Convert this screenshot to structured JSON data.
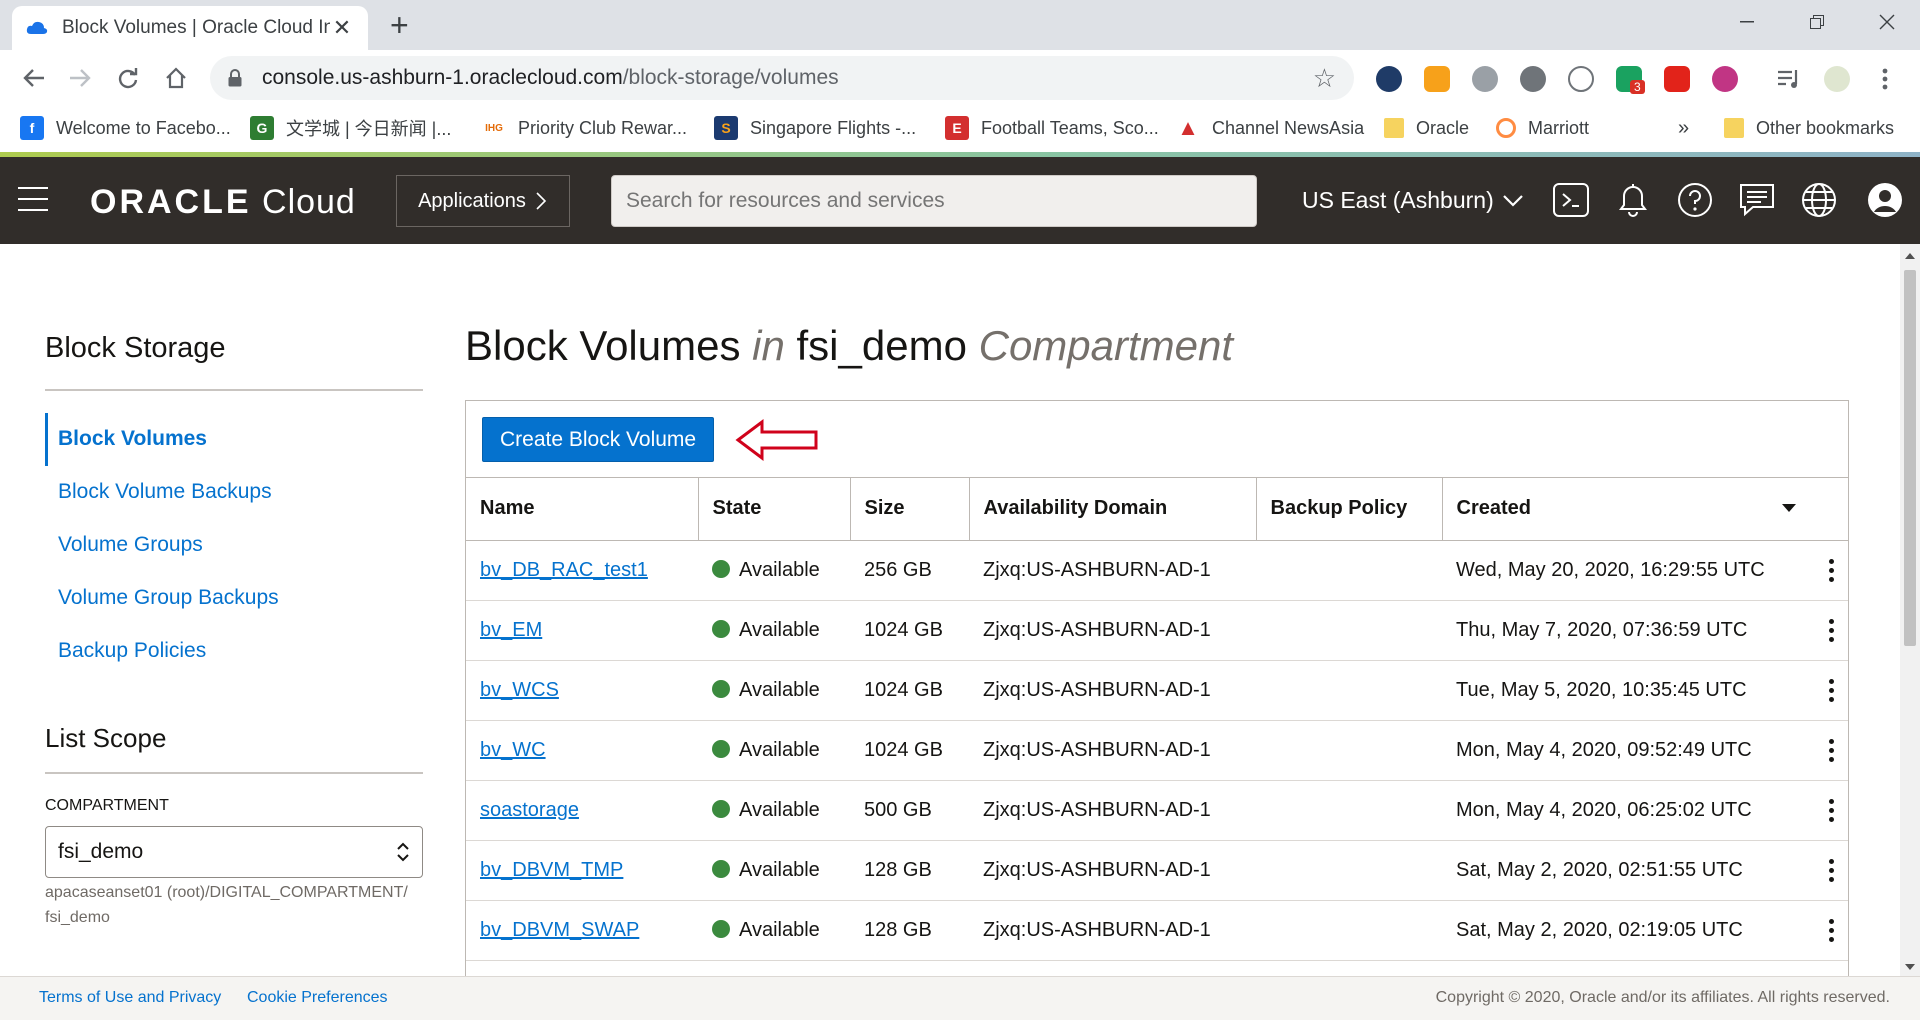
{
  "browser": {
    "tab_title": "Block Volumes | Oracle Cloud Inf",
    "new_tab": "+",
    "url_host": "console.us-ashburn-1.oraclecloud.com",
    "url_path": "/block-storage/volumes",
    "ext_badge": "3",
    "bookmarks": [
      {
        "label": "Welcome to Facebo...",
        "icon": "facebook-icon",
        "color": "#1877f2",
        "glyph": "f"
      },
      {
        "label": "文学城 | 今日新闻 |...",
        "icon": "wenxuecity-icon",
        "color": "#2e7d32",
        "glyph": "G"
      },
      {
        "label": "Priority Club Rewar...",
        "icon": "ihg-icon",
        "color": "#e46c0a",
        "glyph": "IHG"
      },
      {
        "label": "Singapore Flights -...",
        "icon": "singapore-airlines-icon",
        "color": "#1b3a70",
        "glyph": "S"
      },
      {
        "label": "Football Teams, Sco...",
        "icon": "espn-icon",
        "color": "#d32f2f",
        "glyph": "E"
      },
      {
        "label": "Channel NewsAsia",
        "icon": "cna-icon",
        "color": "#d32f2f",
        "glyph": "A"
      },
      {
        "label": "Oracle",
        "icon": "folder-icon"
      },
      {
        "label": "Marriott",
        "icon": "marriott-icon",
        "color": "#ff8c42",
        "glyph": "○"
      }
    ],
    "more_bookmarks": "»",
    "other_bookmarks": "Other bookmarks"
  },
  "header": {
    "logo_bold": "ORACLE",
    "logo_light": " Cloud",
    "applications_label": "Applications",
    "search_placeholder": "Search for resources and services",
    "region_label": "US East (Ashburn)"
  },
  "sidebar": {
    "title": "Block Storage",
    "items": [
      {
        "label": "Block Volumes",
        "active": true
      },
      {
        "label": "Block Volume Backups"
      },
      {
        "label": "Volume Groups"
      },
      {
        "label": "Volume Group Backups"
      },
      {
        "label": "Backup Policies"
      }
    ],
    "scope_title": "List Scope",
    "compartment_label": "COMPARTMENT",
    "compartment_value": "fsi_demo",
    "compartment_path_1": "apacaseanset01 (root)/DIGITAL_COMPARTMENT/",
    "compartment_path_2": "fsi_demo"
  },
  "main": {
    "title_a": "Block Volumes ",
    "title_in": "in",
    "title_b": " fsi_demo ",
    "title_c": "Compartment",
    "create_button": "Create Block Volume",
    "columns": [
      "Name",
      "State",
      "Size",
      "Availability Domain",
      "Backup Policy",
      "Created"
    ],
    "rows": [
      {
        "name": "bv_DB_RAC_test1",
        "state": "Available",
        "size": "256 GB",
        "ad": "Zjxq:US-ASHBURN-AD-1",
        "policy": "",
        "created": "Wed, May 20, 2020, 16:29:55 UTC"
      },
      {
        "name": "bv_EM",
        "state": "Available",
        "size": "1024 GB",
        "ad": "Zjxq:US-ASHBURN-AD-1",
        "policy": "",
        "created": "Thu, May 7, 2020, 07:36:59 UTC"
      },
      {
        "name": "bv_WCS",
        "state": "Available",
        "size": "1024 GB",
        "ad": "Zjxq:US-ASHBURN-AD-1",
        "policy": "",
        "created": "Tue, May 5, 2020, 10:35:45 UTC"
      },
      {
        "name": "bv_WC",
        "state": "Available",
        "size": "1024 GB",
        "ad": "Zjxq:US-ASHBURN-AD-1",
        "policy": "",
        "created": "Mon, May 4, 2020, 09:52:49 UTC"
      },
      {
        "name": "soastorage",
        "state": "Available",
        "size": "500 GB",
        "ad": "Zjxq:US-ASHBURN-AD-1",
        "policy": "",
        "created": "Mon, May 4, 2020, 06:25:02 UTC"
      },
      {
        "name": "bv_DBVM_TMP",
        "state": "Available",
        "size": "128 GB",
        "ad": "Zjxq:US-ASHBURN-AD-1",
        "policy": "",
        "created": "Sat, May 2, 2020, 02:51:55 UTC"
      },
      {
        "name": "bv_DBVM_SWAP",
        "state": "Available",
        "size": "128 GB",
        "ad": "Zjxq:US-ASHBURN-AD-1",
        "policy": "",
        "created": "Sat, May 2, 2020, 02:19:05 UTC"
      }
    ]
  },
  "footer": {
    "terms": "Terms of Use and Privacy",
    "cookies": "Cookie Preferences",
    "copyright": "Copyright © 2020, Oracle and/or its affiliates. All rights reserved."
  },
  "colors": {
    "accent": "#0572ce",
    "header_bg": "#312d2a",
    "available": "#3b8a3e",
    "annotation": "#d0021b"
  }
}
